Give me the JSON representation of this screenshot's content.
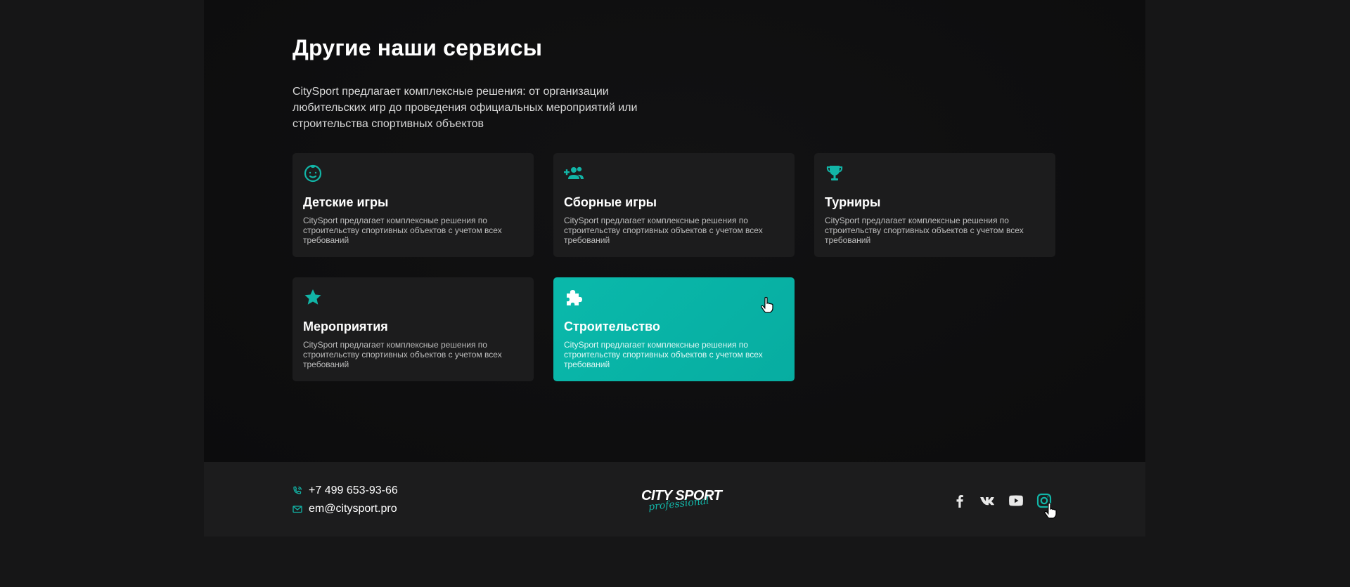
{
  "section": {
    "title": "Другие наши сервисы",
    "description": "CitySport предлагает комплексные решения: от организации любительских игр до проведения официальных мероприятий или строительства спортивных объектов"
  },
  "cards": [
    {
      "title": "Детские игры",
      "description": "CitySport предлагает комплексные решения по строительству спортивных объектов с учетом всех требований",
      "icon": "child-face-icon"
    },
    {
      "title": "Сборные игры",
      "description": "CitySport предлагает комплексные решения по строительству спортивных объектов с учетом всех требований",
      "icon": "group-add-icon"
    },
    {
      "title": "Турниры",
      "description": "CitySport предлагает комплексные решения по строительству спортивных объектов с учетом всех требований",
      "icon": "trophy-icon"
    },
    {
      "title": "Мероприятия",
      "description": "CitySport предлагает комплексные решения по строительству спортивных объектов с учетом всех требований",
      "icon": "star-icon"
    },
    {
      "title": "Строительство",
      "description": "CitySport предлагает комплексные решения по строительству спортивных объектов с учетом всех требований",
      "icon": "puzzle-icon",
      "active": true
    }
  ],
  "footer": {
    "phone": "+7 499 653-93-66",
    "email": "em@citysport.pro",
    "logo_main": "CITY SPORT",
    "logo_script": "professional",
    "social": [
      "facebook-icon",
      "vk-icon",
      "youtube-icon",
      "instagram-icon"
    ]
  },
  "colors": {
    "accent": "#12b5a7",
    "card_bg": "#1c1c1d",
    "page_bg": "#0e0e0f"
  }
}
